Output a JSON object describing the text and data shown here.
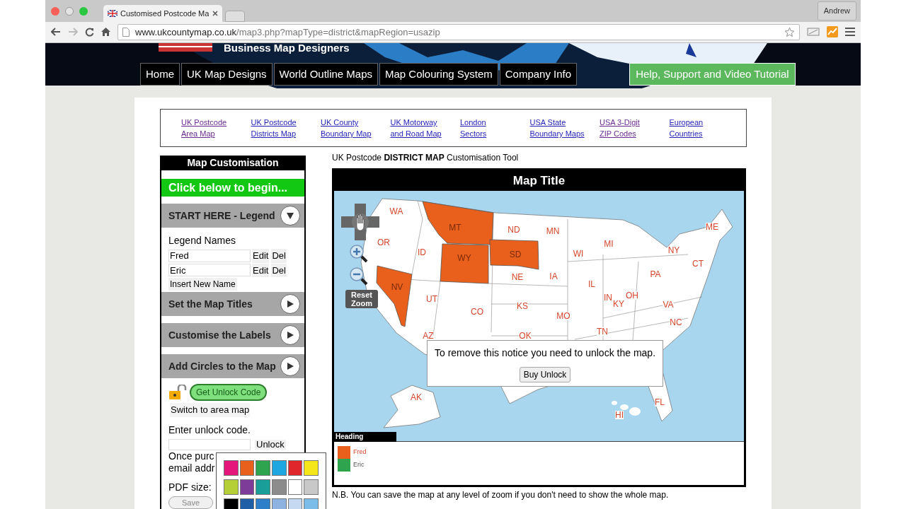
{
  "browser": {
    "tab_title": "Customised Postcode Ma",
    "profile": "Andrew",
    "url_host": "www.ukcountymap.co.uk",
    "url_path": "/map3.php?mapType=district&mapRegion=usazip"
  },
  "banner": {
    "tagline": "Business Map Designers"
  },
  "nav": [
    {
      "label": "Home",
      "kind": "main"
    },
    {
      "label": "UK Map Designs",
      "kind": "main"
    },
    {
      "label": "World Outline Maps",
      "kind": "main"
    },
    {
      "label": "Map Colouring System",
      "kind": "main"
    },
    {
      "label": "Company Info",
      "kind": "main"
    },
    {
      "label": "Help, Support and Video Tutorial",
      "kind": "help"
    }
  ],
  "links": [
    {
      "lines": [
        "UK Postcode",
        "Area Map"
      ],
      "visited": true
    },
    {
      "lines": [
        "UK Postcode",
        "Districts Map"
      ],
      "visited": false
    },
    {
      "lines": [
        "UK County",
        "Boundary Map"
      ],
      "visited": false
    },
    {
      "lines": [
        "UK Motorway",
        "and Road Map"
      ],
      "visited": false
    },
    {
      "lines": [
        "London",
        "Sectors"
      ],
      "visited": false
    },
    {
      "lines": [
        "USA State",
        "Boundary Maps"
      ],
      "visited": false
    },
    {
      "lines": [
        "USA 3-Digit",
        "ZIP Codes"
      ],
      "visited": true
    },
    {
      "lines": [
        "European",
        "Countries"
      ],
      "visited": false
    }
  ],
  "panel": {
    "title": "Map Customisation",
    "begin": "Click below to begin...",
    "sections": [
      {
        "label": "START HERE - Legend",
        "expanded": true
      },
      {
        "label": "Set the Map Titles",
        "expanded": false
      },
      {
        "label": "Customise the Labels",
        "expanded": false
      },
      {
        "label": "Add Circles to the Map",
        "expanded": false
      }
    ],
    "legend_heading": "Legend Names",
    "legend_names": [
      {
        "name": "Fred",
        "edit": "Edit",
        "delete": "Del"
      },
      {
        "name": "Eric",
        "edit": "Edit",
        "delete": "Del"
      }
    ],
    "insert": "Insert New Name",
    "unlock_code_button": "Get Unlock Code",
    "switch": "Switch to area map",
    "enter_code": "Enter unlock code.",
    "unlock": "Unlock",
    "note_lines": [
      "Once purc",
      "email addr"
    ],
    "pdf_label": "PDF size:",
    "save": "Save"
  },
  "tool_heading": "UK Postcode **DISTRICT MAP** Customisation Tool",
  "map": {
    "title": "Map Title",
    "reset_zoom": "Reset Zoom",
    "states": [
      {
        "abbr": "WA",
        "color": "#ffffff"
      },
      {
        "abbr": "OR",
        "color": "#ffffff"
      },
      {
        "abbr": "ID",
        "color": "#ffffff"
      },
      {
        "abbr": "MT",
        "color": "#e8601c"
      },
      {
        "abbr": "WY",
        "color": "#e8601c"
      },
      {
        "abbr": "ND",
        "color": "#ffffff"
      },
      {
        "abbr": "SD",
        "color": "#e8601c"
      },
      {
        "abbr": "NV",
        "color": "#e8601c"
      },
      {
        "abbr": "UT",
        "color": "#ffffff"
      },
      {
        "abbr": "CO",
        "color": "#ffffff"
      },
      {
        "abbr": "NE",
        "color": "#ffffff"
      },
      {
        "abbr": "KS",
        "color": "#ffffff"
      },
      {
        "abbr": "OK",
        "color": "#ffffff"
      },
      {
        "abbr": "AZ",
        "color": "#ffffff"
      },
      {
        "abbr": "MN",
        "color": "#ffffff"
      },
      {
        "abbr": "WI",
        "color": "#ffffff"
      },
      {
        "abbr": "MI",
        "color": "#ffffff"
      },
      {
        "abbr": "IA",
        "color": "#ffffff"
      },
      {
        "abbr": "IL",
        "color": "#ffffff"
      },
      {
        "abbr": "IN",
        "color": "#ffffff"
      },
      {
        "abbr": "MO",
        "color": "#ffffff"
      },
      {
        "abbr": "OH",
        "color": "#ffffff"
      },
      {
        "abbr": "KY",
        "color": "#ffffff"
      },
      {
        "abbr": "TN",
        "color": "#ffffff"
      },
      {
        "abbr": "NC",
        "color": "#ffffff"
      },
      {
        "abbr": "VA",
        "color": "#ffffff"
      },
      {
        "abbr": "PA",
        "color": "#ffffff"
      },
      {
        "abbr": "NY",
        "color": "#ffffff"
      },
      {
        "abbr": "ME",
        "color": "#ffffff"
      },
      {
        "abbr": "CT",
        "color": "#ffffff"
      },
      {
        "abbr": "FL",
        "color": "#ffffff"
      },
      {
        "abbr": "HI",
        "color": "#ffffff"
      },
      {
        "abbr": "AK",
        "color": "#ffffff"
      }
    ],
    "notice": "To remove this notice you need to unlock the map.",
    "buy": "Buy Unlock",
    "legend_title": "Heading",
    "legend": [
      {
        "name": "Fred",
        "color": "#e8601c",
        "highlighted": true
      },
      {
        "name": "Eric",
        "color": "#2ea44f",
        "highlighted": false
      }
    ]
  },
  "palette": [
    {
      "color": "#e5177b"
    },
    {
      "color": "#e8601c"
    },
    {
      "color": "#2ea44f"
    },
    {
      "color": "#1fa7e1"
    },
    {
      "color": "#e0262b"
    },
    {
      "color": "#f5e61a"
    },
    {
      "color": "#b5cf36"
    },
    {
      "color": "#7d3c98"
    },
    {
      "color": "#1a9e9a"
    },
    {
      "color": "#8c8c8c"
    },
    {
      "color": "#ffffff"
    },
    {
      "color": "#c8c8c8"
    },
    {
      "color": "#000000"
    },
    {
      "color": "#1e5fa8"
    },
    {
      "color": "#2d7fc9"
    },
    {
      "color": "#8fb3e0"
    },
    {
      "color": "#c5d9f0"
    },
    {
      "color": "#7bbde8"
    }
  ],
  "footnote": "N.B. You can save the map at any level of zoom if you don't need to show the whole map."
}
